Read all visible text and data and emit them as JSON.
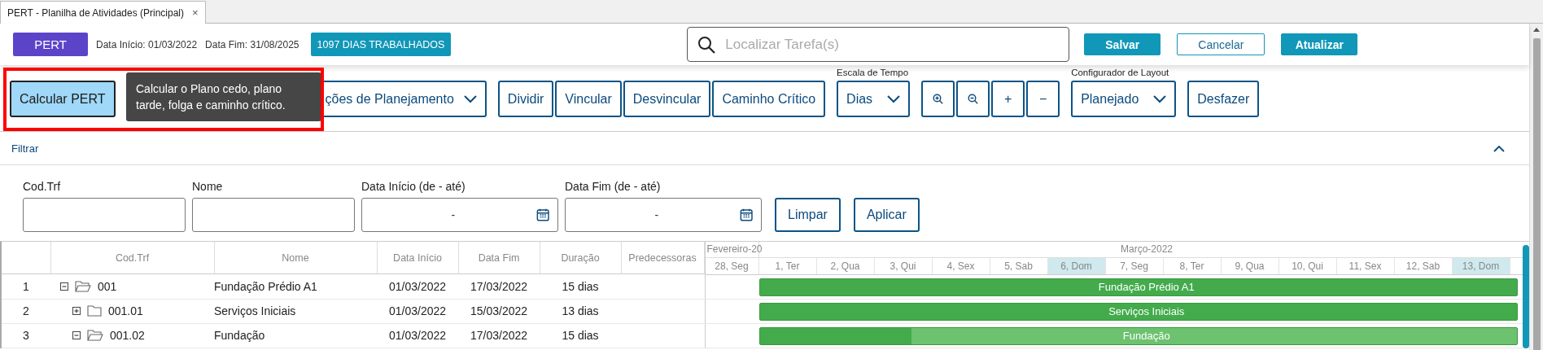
{
  "tab": {
    "label": "PERT - Planilha de Atividades (Principal)",
    "close": "×"
  },
  "header": {
    "title_button": "PERT",
    "start_label": "Data Início:",
    "start_value": "01/03/2022",
    "end_label": "Data Fim:",
    "end_value": "31/08/2025",
    "badge": "1097 DIAS TRABALHADOS",
    "search": {
      "placeholder": "Localizar Tarefa(s)"
    },
    "buttons": [
      {
        "label": "Salvar",
        "kind": "primary"
      },
      {
        "label": "Cancelar",
        "kind": "outline"
      },
      {
        "label": "Atualizar",
        "kind": "primary"
      }
    ]
  },
  "toolbar": {
    "groups": [
      {
        "items": [
          {
            "kind": "button",
            "label": "Calcular PERT",
            "active": true
          }
        ]
      },
      {
        "items": [
          {
            "kind": "dropdown",
            "label": "ções de Planejamento",
            "active": false
          }
        ]
      },
      {
        "items": [
          {
            "kind": "button",
            "label": "Dividir",
            "active": false
          },
          {
            "kind": "button",
            "label": "Vincular",
            "active": false
          },
          {
            "kind": "button",
            "label": "Desvincular",
            "active": false
          },
          {
            "kind": "button",
            "label": "Caminho Crítico",
            "active": false
          }
        ]
      },
      {
        "caption": "Escala de Tempo",
        "items": [
          {
            "kind": "dropdown",
            "label": "Dias",
            "active": false
          }
        ]
      },
      {
        "items": [
          {
            "kind": "zoom_in",
            "active": false
          },
          {
            "kind": "zoom_out",
            "active": false
          },
          {
            "kind": "button",
            "label": "+",
            "active": false
          },
          {
            "kind": "button",
            "label": "−",
            "active": false
          }
        ]
      },
      {
        "caption": "Configurador de Layout",
        "items": [
          {
            "kind": "dropdown",
            "label": "Planejado",
            "active": false
          }
        ]
      },
      {
        "items": [
          {
            "kind": "button",
            "label": "Desfazer",
            "active": false
          }
        ]
      }
    ],
    "tooltip": "Calcular o Plano cedo, plano tarde, folga e caminho crítico.",
    "highlighted": true
  },
  "filter": {
    "title": "Filtrar",
    "expanded": true,
    "fields": [
      {
        "label": "Cod.Trf",
        "kind": "text"
      },
      {
        "label": "Nome",
        "kind": "text"
      },
      {
        "label": "Data Início (de - até)",
        "kind": "date_range",
        "value": "-"
      },
      {
        "label": "Data Fim (de - até)",
        "kind": "date_range",
        "value": "-"
      }
    ],
    "buttons": [
      "Limpar",
      "Aplicar"
    ]
  },
  "table": {
    "columns": [
      "Cod.Trf",
      "Nome",
      "Data Início",
      "Data Fim",
      "Duração",
      "Predecessoras"
    ],
    "rows": [
      {
        "number": "1",
        "code": "001",
        "name": "Fundação Prédio A1",
        "start": "01/03/2022",
        "end": "17/03/2022",
        "duration": "15 dias",
        "expanded": true,
        "children": [
          {
            "number": "2",
            "code": "001.01",
            "name": "Serviços Iniciais",
            "start": "01/03/2022",
            "end": "15/03/2022",
            "duration": "13 dias",
            "expanded": false
          },
          {
            "number": "3",
            "code": "001.02",
            "name": "Fundação",
            "start": "01/03/2022",
            "end": "17/03/2022",
            "duration": "15 dias",
            "expanded": true
          }
        ]
      }
    ]
  },
  "gantt": {
    "months": [
      {
        "label": "Fevereiro-20",
        "days": [
          {
            "label": "28, Seg",
            "highlighted": false
          }
        ]
      },
      {
        "label": "Março-2022",
        "days": [
          {
            "label": "1, Ter",
            "highlighted": false
          },
          {
            "label": "2, Qua",
            "highlighted": false
          },
          {
            "label": "3, Qui",
            "highlighted": false
          },
          {
            "label": "4, Sex",
            "highlighted": false
          },
          {
            "label": "5, Sab",
            "highlighted": false
          },
          {
            "label": "6, Dom",
            "highlighted": true
          },
          {
            "label": "7, Seg",
            "highlighted": false
          },
          {
            "label": "8, Ter",
            "highlighted": false
          },
          {
            "label": "9, Qua",
            "highlighted": false
          },
          {
            "label": "10, Qui",
            "highlighted": false
          },
          {
            "label": "11, Sex",
            "highlighted": false
          },
          {
            "label": "12, Sab",
            "highlighted": false
          },
          {
            "label": "13, Dom",
            "highlighted": true
          }
        ]
      }
    ],
    "bars": [
      {
        "label": "Fundação Prédio A1",
        "level": 1
      },
      {
        "label": "Serviços Iniciais",
        "level": 1
      },
      {
        "label": "Fundação",
        "level": 0.2
      }
    ]
  }
}
